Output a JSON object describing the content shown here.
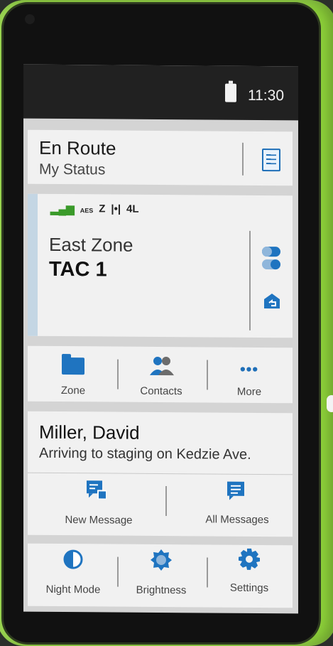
{
  "status_bar": {
    "time": "11:30"
  },
  "status_card": {
    "title": "En Route",
    "subtitle": "My Status"
  },
  "zone_card": {
    "zone": "East Zone",
    "channel": "TAC 1",
    "indicators": [
      "AES",
      "Z",
      "|•|",
      "4L"
    ]
  },
  "nav": [
    {
      "label": "Zone",
      "icon": "folder-icon"
    },
    {
      "label": "Contacts",
      "icon": "contacts-icon"
    },
    {
      "label": "More",
      "icon": "more-icon"
    }
  ],
  "message": {
    "sender": "Miller, David",
    "text": "Arriving to staging on Kedzie Ave.",
    "new_label": "New Message",
    "all_label": "All Messages"
  },
  "settings": [
    {
      "label": "Night Mode",
      "icon": "night-mode-icon"
    },
    {
      "label": "Brightness",
      "icon": "brightness-icon"
    },
    {
      "label": "Settings",
      "icon": "gear-icon"
    }
  ],
  "colors": {
    "accent": "#1f6fb8",
    "case": "#8ed23a",
    "signal": "#3a9a2a"
  }
}
